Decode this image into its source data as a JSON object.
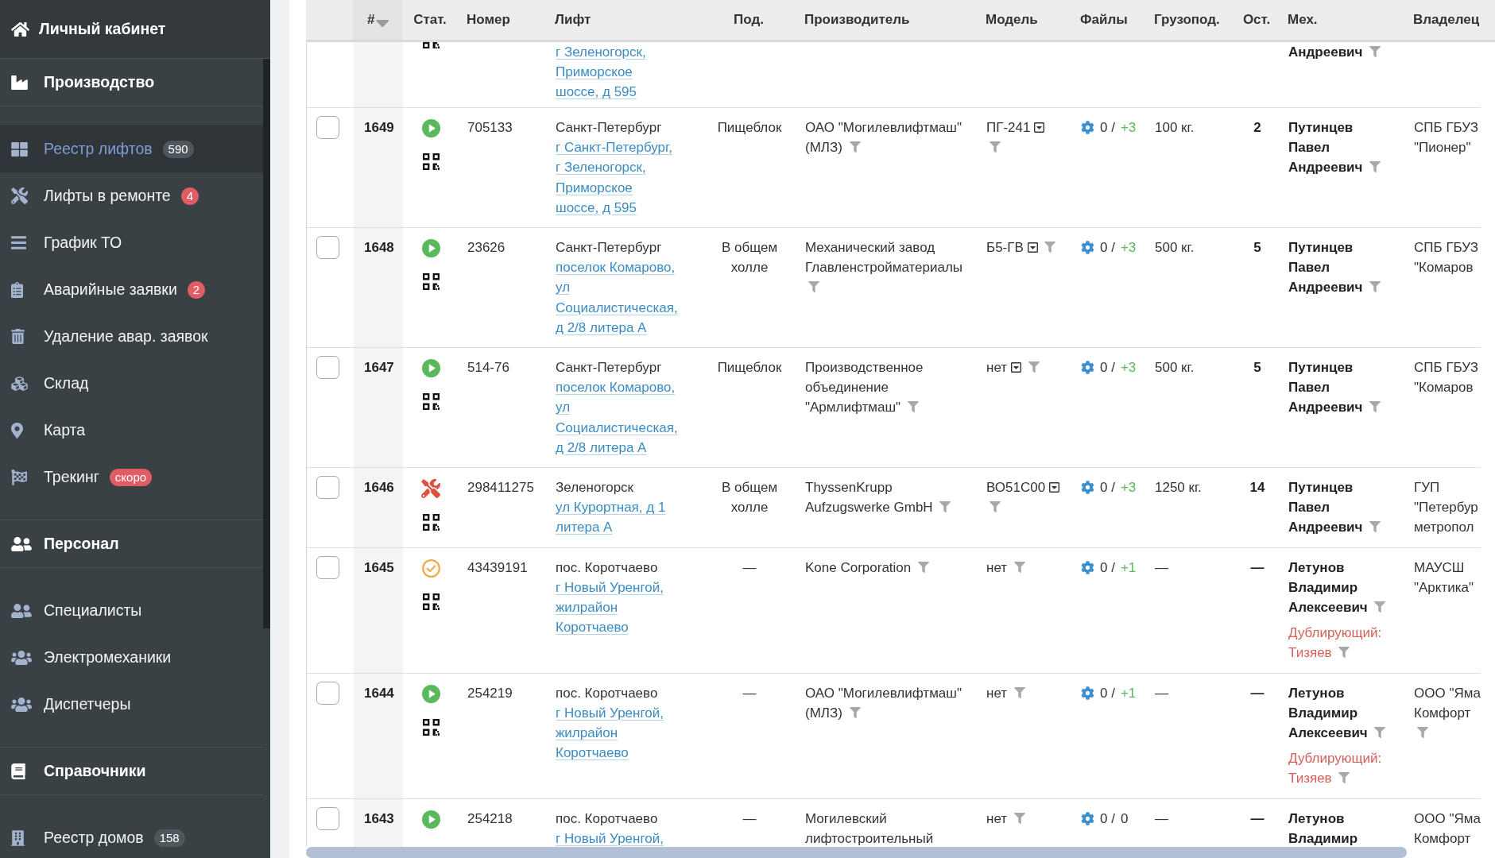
{
  "sidebar": {
    "home": {
      "label": "Личный кабинет"
    },
    "sections": [
      {
        "title": "Производство",
        "items": [
          {
            "label": "Реестр лифтов",
            "selected": true,
            "badge": {
              "text": "590",
              "color": "#50575c"
            }
          },
          {
            "label": "Лифты в ремонте",
            "selected": false,
            "badge": {
              "text": "4",
              "color": "#e05d65"
            }
          },
          {
            "label": "График ТО",
            "selected": false
          },
          {
            "label": "Аварийные заявки",
            "selected": false,
            "badge": {
              "text": "2",
              "color": "#e05d65"
            }
          },
          {
            "label": "Удаление авар. заявок",
            "selected": false
          },
          {
            "label": "Склад",
            "selected": false
          },
          {
            "label": "Карта",
            "selected": false
          },
          {
            "label": "Трекинг",
            "selected": false,
            "badge": {
              "text": "скоро",
              "color": "#e05d65"
            }
          }
        ]
      },
      {
        "title": "Персонал",
        "items": [
          {
            "label": "Специалисты",
            "selected": false
          },
          {
            "label": "Электромеханики",
            "selected": false
          },
          {
            "label": "Диспетчеры",
            "selected": false
          }
        ]
      },
      {
        "title": "Справочники",
        "items": [
          {
            "label": "Реестр домов",
            "selected": false,
            "badge": {
              "text": "158",
              "color": "#50575c"
            }
          }
        ]
      }
    ]
  },
  "table": {
    "columns": [
      {
        "label": "#",
        "sorted": true
      },
      {
        "label": "Стат.",
        "sorted": false
      },
      {
        "label": "Номер",
        "sorted": false
      },
      {
        "label": "Лифт",
        "sorted": false
      },
      {
        "label": "Под.",
        "sorted": false
      },
      {
        "label": "Производитель",
        "sorted": false
      },
      {
        "label": "Модель",
        "sorted": false
      },
      {
        "label": "Файлы",
        "sorted": false
      },
      {
        "label": "Грузопод.",
        "sorted": false
      },
      {
        "label": "Ост.",
        "sorted": false
      },
      {
        "label": "Мех.",
        "sorted": false
      },
      {
        "label": "Владелец",
        "sorted": false
      }
    ],
    "cut_row": {
      "qr": true,
      "address": [
        "г Зеленогорск,",
        "Приморское",
        "шоссе, д 595"
      ],
      "mechanic": "Андреевич",
      "mechanic_filter": true
    },
    "rows": [
      {
        "id": "1649",
        "checked": false,
        "status": {
          "kind": "running"
        },
        "qr": true,
        "number": "705133",
        "city": "Санкт-Петербург",
        "address": [
          "г Санкт-Петербург,",
          "г Зеленогорск,",
          "Приморское",
          "шоссе, д 595"
        ],
        "entrance": "Пищеблок",
        "maker": [
          "ОАО \"Могилевлифтмаш\"",
          "(МЛЗ)"
        ],
        "model": "ПГ-241",
        "model_menu": true,
        "files": {
          "count": "0 /",
          "added": "+3",
          "added_highlighted": true
        },
        "capacity": "100 кг.",
        "stops": "2",
        "mechanic": "Путинцев Павел Андреевич",
        "owner": "СПБ ГБУЗ \"Пионер\"",
        "filters": {
          "maker": true,
          "model": true,
          "mechanic": true,
          "owner": false
        }
      },
      {
        "id": "1648",
        "checked": false,
        "status": {
          "kind": "running"
        },
        "qr": true,
        "number": "23626",
        "city": "Санкт-Петербург",
        "address": [
          "поселок Комарово,",
          "ул",
          "Социалистическая,",
          "д 2/8 литера А"
        ],
        "entrance": "В общем холле",
        "maker": [
          "Механический завод",
          "Главленстройматериалы"
        ],
        "model": "Б5-ГВ",
        "model_menu": true,
        "files": {
          "count": "0 /",
          "added": "+3",
          "added_highlighted": true
        },
        "capacity": "500 кг.",
        "stops": "5",
        "mechanic": "Путинцев Павел Андреевич",
        "owner": "СПБ ГБУЗ \"Комаров",
        "filters": {
          "maker": true,
          "model": true,
          "mechanic": true,
          "owner": false
        }
      },
      {
        "id": "1647",
        "checked": false,
        "status": {
          "kind": "running"
        },
        "qr": true,
        "number": "514-76",
        "city": "Санкт-Петербург",
        "address": [
          "поселок Комарово,",
          "ул",
          "Социалистическая,",
          "д 2/8 литера А"
        ],
        "entrance": "Пищеблок",
        "maker": [
          "Производственное",
          "объединение",
          "\"Армлифтмаш\""
        ],
        "model": "нет",
        "model_menu": true,
        "files": {
          "count": "0 /",
          "added": "+3",
          "added_highlighted": true
        },
        "capacity": "500 кг.",
        "stops": "5",
        "mechanic": "Путинцев Павел Андреевич",
        "owner": "СПБ ГБУЗ \"Комаров",
        "filters": {
          "maker": true,
          "model": true,
          "mechanic": true,
          "owner": false
        }
      },
      {
        "id": "1646",
        "checked": false,
        "status": {
          "kind": "repair"
        },
        "qr": true,
        "number": "298411275",
        "city": "Зеленогорск",
        "address": [
          "ул Курортная, д 1",
          "литера А"
        ],
        "entrance": "В общем холле",
        "maker": [
          "ThyssenKrupp",
          "Aufzugswerke GmbH"
        ],
        "model": "ВО51С00",
        "model_menu": true,
        "files": {
          "count": "0 /",
          "added": "+3",
          "added_highlighted": true
        },
        "capacity": "1250 кг.",
        "stops": "14",
        "mechanic": "Путинцев Павел Андреевич",
        "owner": "ГУП \"Петербур метропол",
        "filters": {
          "maker": true,
          "model": true,
          "mechanic": true,
          "owner": false
        }
      },
      {
        "id": "1645",
        "checked": false,
        "status": {
          "kind": "done"
        },
        "qr": true,
        "number": "43439191",
        "city": "пос. Коротчаево",
        "address": [
          "г Новый Уренгой,",
          "жилрайон",
          "Коротчаево"
        ],
        "entrance": "—",
        "maker": [
          "Kone Corporation"
        ],
        "model": "нет",
        "model_menu": false,
        "files": {
          "count": "0 /",
          "added": "+1",
          "added_highlighted": true
        },
        "capacity": "—",
        "stops": "—",
        "mechanic": "Летунов Владимир Алексеевич",
        "backup": {
          "label": "Дублирующий:",
          "name": "Тизяев"
        },
        "owner": "МАУСШ \"Арктика\"",
        "filters": {
          "maker": true,
          "model": true,
          "mechanic": true,
          "backup": true,
          "owner": false
        }
      },
      {
        "id": "1644",
        "checked": false,
        "status": {
          "kind": "running"
        },
        "qr": true,
        "number": "254219",
        "city": "пос. Коротчаево",
        "address": [
          "г Новый Уренгой,",
          "жилрайон",
          "Коротчаево"
        ],
        "entrance": "—",
        "maker": [
          "ОАО \"Могилевлифтмаш\"",
          "(МЛЗ)"
        ],
        "model": "нет",
        "model_menu": false,
        "files": {
          "count": "0 /",
          "added": "+1",
          "added_highlighted": true
        },
        "capacity": "—",
        "stops": "—",
        "mechanic": "Летунов Владимир Алексеевич",
        "backup": {
          "label": "Дублирующий:",
          "name": "Тизяев"
        },
        "owner": "ООО \"Яма Комфорт",
        "filters": {
          "maker": true,
          "model": true,
          "mechanic": true,
          "backup": true,
          "owner": true
        }
      },
      {
        "id": "1643",
        "checked": false,
        "status": {
          "kind": "running"
        },
        "qr": false,
        "number": "254218",
        "city": "пос. Коротчаево",
        "address": [
          "г Новый Уренгой,"
        ],
        "entrance": "—",
        "maker": [
          "Могилевский",
          "лифтостроительный"
        ],
        "model": "нет",
        "model_menu": false,
        "files": {
          "count": "0 /",
          "added": "0",
          "added_highlighted": false
        },
        "capacity": "—",
        "stops": "—",
        "mechanic": "Летунов Владимир",
        "owner": "ООО \"Яма Комфорт",
        "filters": {
          "maker": false,
          "model": true,
          "mechanic": false,
          "owner": false
        }
      }
    ]
  }
}
